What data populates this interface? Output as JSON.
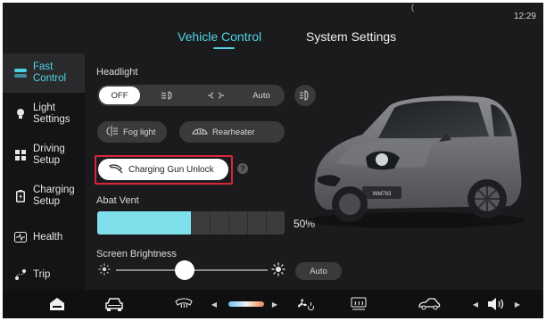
{
  "status_bar": {
    "time": "12:29",
    "notch_glyph": "("
  },
  "tabs": [
    {
      "label": "Vehicle Control",
      "active": true
    },
    {
      "label": "System Settings",
      "active": false
    }
  ],
  "sidebar": {
    "items": [
      {
        "label": "Fast Control",
        "icon": "toggle-icon",
        "active": true
      },
      {
        "label": "Light Settings",
        "icon": "bulb-icon",
        "active": false
      },
      {
        "label": "Driving Setup",
        "icon": "steering-grid-icon",
        "active": false
      },
      {
        "label": "Charging Setup",
        "icon": "battery-icon",
        "active": false
      },
      {
        "label": "Health",
        "icon": "heartbeat-icon",
        "active": false
      },
      {
        "label": "Trip",
        "icon": "route-icon",
        "active": false
      }
    ]
  },
  "headlight": {
    "label": "Headlight",
    "options": [
      {
        "label": "OFF",
        "selected": true
      },
      {
        "label": "",
        "icon": "low-beam-icon"
      },
      {
        "label": "",
        "icon": "position-light-icon"
      },
      {
        "label": "Auto"
      }
    ],
    "extra_icon": "high-beam-icon"
  },
  "buttons": {
    "fog_light": "Fog light",
    "rear_heater": "Rearheater",
    "charging_gun_unlock": "Charging Gun Unlock",
    "help": "?"
  },
  "vent": {
    "label": "Abat Vent",
    "value_text": "50%",
    "level": 0.5
  },
  "brightness": {
    "label": "Screen Brightness",
    "level": 0.45,
    "auto_label": "Auto"
  },
  "car": {
    "plate": "WM783",
    "color": "#6e6f72"
  },
  "bottom_bar": {
    "items": [
      "home-icon",
      "car-icon",
      "defrost-front-icon",
      "temperature-slider",
      "fan-icon",
      "defrost-rear-icon",
      "car-outline-icon",
      "volume-icon"
    ]
  },
  "colors": {
    "accent": "#4fd3e2",
    "highlight_border": "#d8283a",
    "vent_fill": "#7fe0ec"
  }
}
